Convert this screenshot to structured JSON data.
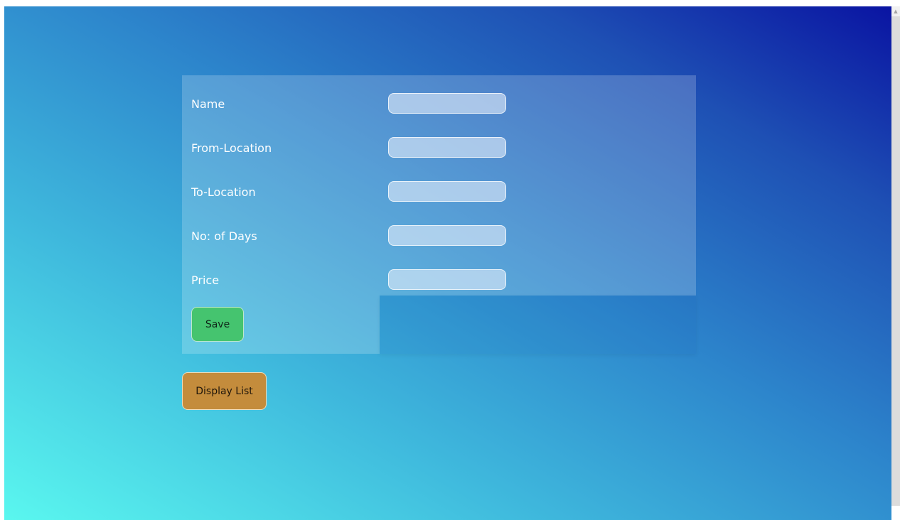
{
  "form": {
    "fields": [
      {
        "label": "Name",
        "value": ""
      },
      {
        "label": "From-Location",
        "value": ""
      },
      {
        "label": "To-Location",
        "value": ""
      },
      {
        "label": "No: of Days",
        "value": ""
      },
      {
        "label": "Price",
        "value": ""
      }
    ],
    "save_label": "Save"
  },
  "display_list_label": "Display List",
  "scrollbar": {
    "up_arrow": "▲"
  },
  "colors": {
    "gradient_start": "#5af7ef",
    "gradient_end": "#0a14a2",
    "save_button": "#45c46f",
    "display_list_button": "#c48c3c"
  }
}
